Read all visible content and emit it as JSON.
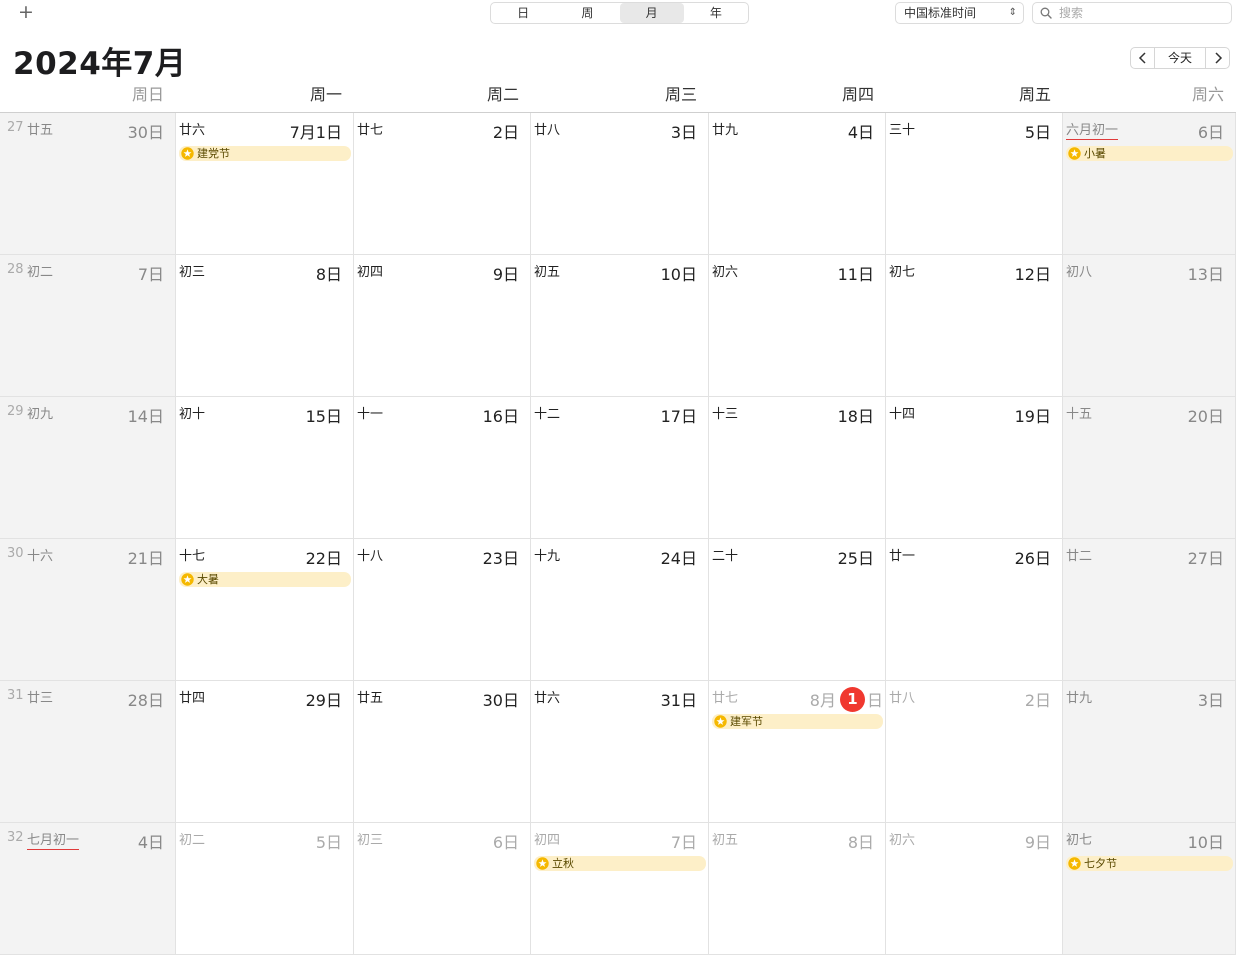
{
  "toolbar": {
    "add_label": "+",
    "views": [
      "日",
      "周",
      "月",
      "年"
    ],
    "active_view": "月",
    "timezone": "中国标准时间",
    "search_placeholder": "搜索"
  },
  "header": {
    "month_title": "2024年7月",
    "today_label": "今天"
  },
  "weekdays": [
    "周日",
    "周一",
    "周二",
    "周三",
    "周四",
    "周五",
    "周六"
  ],
  "weeks": [
    {
      "week": "27",
      "days": [
        {
          "lunar": "廿五",
          "date": "30日",
          "dim": true
        },
        {
          "lunar": "廿六",
          "date": "7月1日",
          "event": "建党节"
        },
        {
          "lunar": "廿七",
          "date": "2日"
        },
        {
          "lunar": "廿八",
          "date": "3日"
        },
        {
          "lunar": "廿九",
          "date": "4日"
        },
        {
          "lunar": "三十",
          "date": "5日"
        },
        {
          "lunar": "六月初一",
          "date": "6日",
          "underline": true,
          "event": "小暑"
        }
      ]
    },
    {
      "week": "28",
      "days": [
        {
          "lunar": "初二",
          "date": "7日"
        },
        {
          "lunar": "初三",
          "date": "8日"
        },
        {
          "lunar": "初四",
          "date": "9日"
        },
        {
          "lunar": "初五",
          "date": "10日"
        },
        {
          "lunar": "初六",
          "date": "11日"
        },
        {
          "lunar": "初七",
          "date": "12日"
        },
        {
          "lunar": "初八",
          "date": "13日"
        }
      ]
    },
    {
      "week": "29",
      "days": [
        {
          "lunar": "初九",
          "date": "14日"
        },
        {
          "lunar": "初十",
          "date": "15日"
        },
        {
          "lunar": "十一",
          "date": "16日"
        },
        {
          "lunar": "十二",
          "date": "17日"
        },
        {
          "lunar": "十三",
          "date": "18日"
        },
        {
          "lunar": "十四",
          "date": "19日"
        },
        {
          "lunar": "十五",
          "date": "20日"
        }
      ]
    },
    {
      "week": "30",
      "days": [
        {
          "lunar": "十六",
          "date": "21日"
        },
        {
          "lunar": "十七",
          "date": "22日",
          "event": "大暑"
        },
        {
          "lunar": "十八",
          "date": "23日"
        },
        {
          "lunar": "十九",
          "date": "24日"
        },
        {
          "lunar": "二十",
          "date": "25日"
        },
        {
          "lunar": "廿一",
          "date": "26日"
        },
        {
          "lunar": "廿二",
          "date": "27日"
        }
      ]
    },
    {
      "week": "31",
      "days": [
        {
          "lunar": "廿三",
          "date": "28日"
        },
        {
          "lunar": "廿四",
          "date": "29日"
        },
        {
          "lunar": "廿五",
          "date": "30日"
        },
        {
          "lunar": "廿六",
          "date": "31日"
        },
        {
          "lunar": "廿七",
          "date": "8月",
          "date_day": "1",
          "date_suffix": "日",
          "dim": true,
          "today": true,
          "event": "建军节"
        },
        {
          "lunar": "廿八",
          "date": "2日",
          "dim": true
        },
        {
          "lunar": "廿九",
          "date": "3日",
          "dim": true
        }
      ]
    },
    {
      "week": "32",
      "days": [
        {
          "lunar": "七月初一",
          "date": "4日",
          "underline": true,
          "dim": true
        },
        {
          "lunar": "初二",
          "date": "5日",
          "dim": true
        },
        {
          "lunar": "初三",
          "date": "6日",
          "dim": true
        },
        {
          "lunar": "初四",
          "date": "7日",
          "dim": true,
          "event": "立秋"
        },
        {
          "lunar": "初五",
          "date": "8日",
          "dim": true
        },
        {
          "lunar": "初六",
          "date": "9日",
          "dim": true
        },
        {
          "lunar": "初七",
          "date": "10日",
          "dim": true,
          "event": "七夕节"
        }
      ]
    }
  ],
  "colors": {
    "today_badge": "#f0382f",
    "event_bg": "#fdefc8",
    "event_star": "#f5b800",
    "lunar_underline": "#e03a3a",
    "weekend_bg": "#f3f3f3"
  },
  "icons": {
    "add": "plus-icon",
    "search": "magnifier-icon",
    "prev": "chevron-left-icon",
    "next": "chevron-right-icon",
    "event": "star-circle-icon",
    "select": "updown-caret-icon"
  }
}
